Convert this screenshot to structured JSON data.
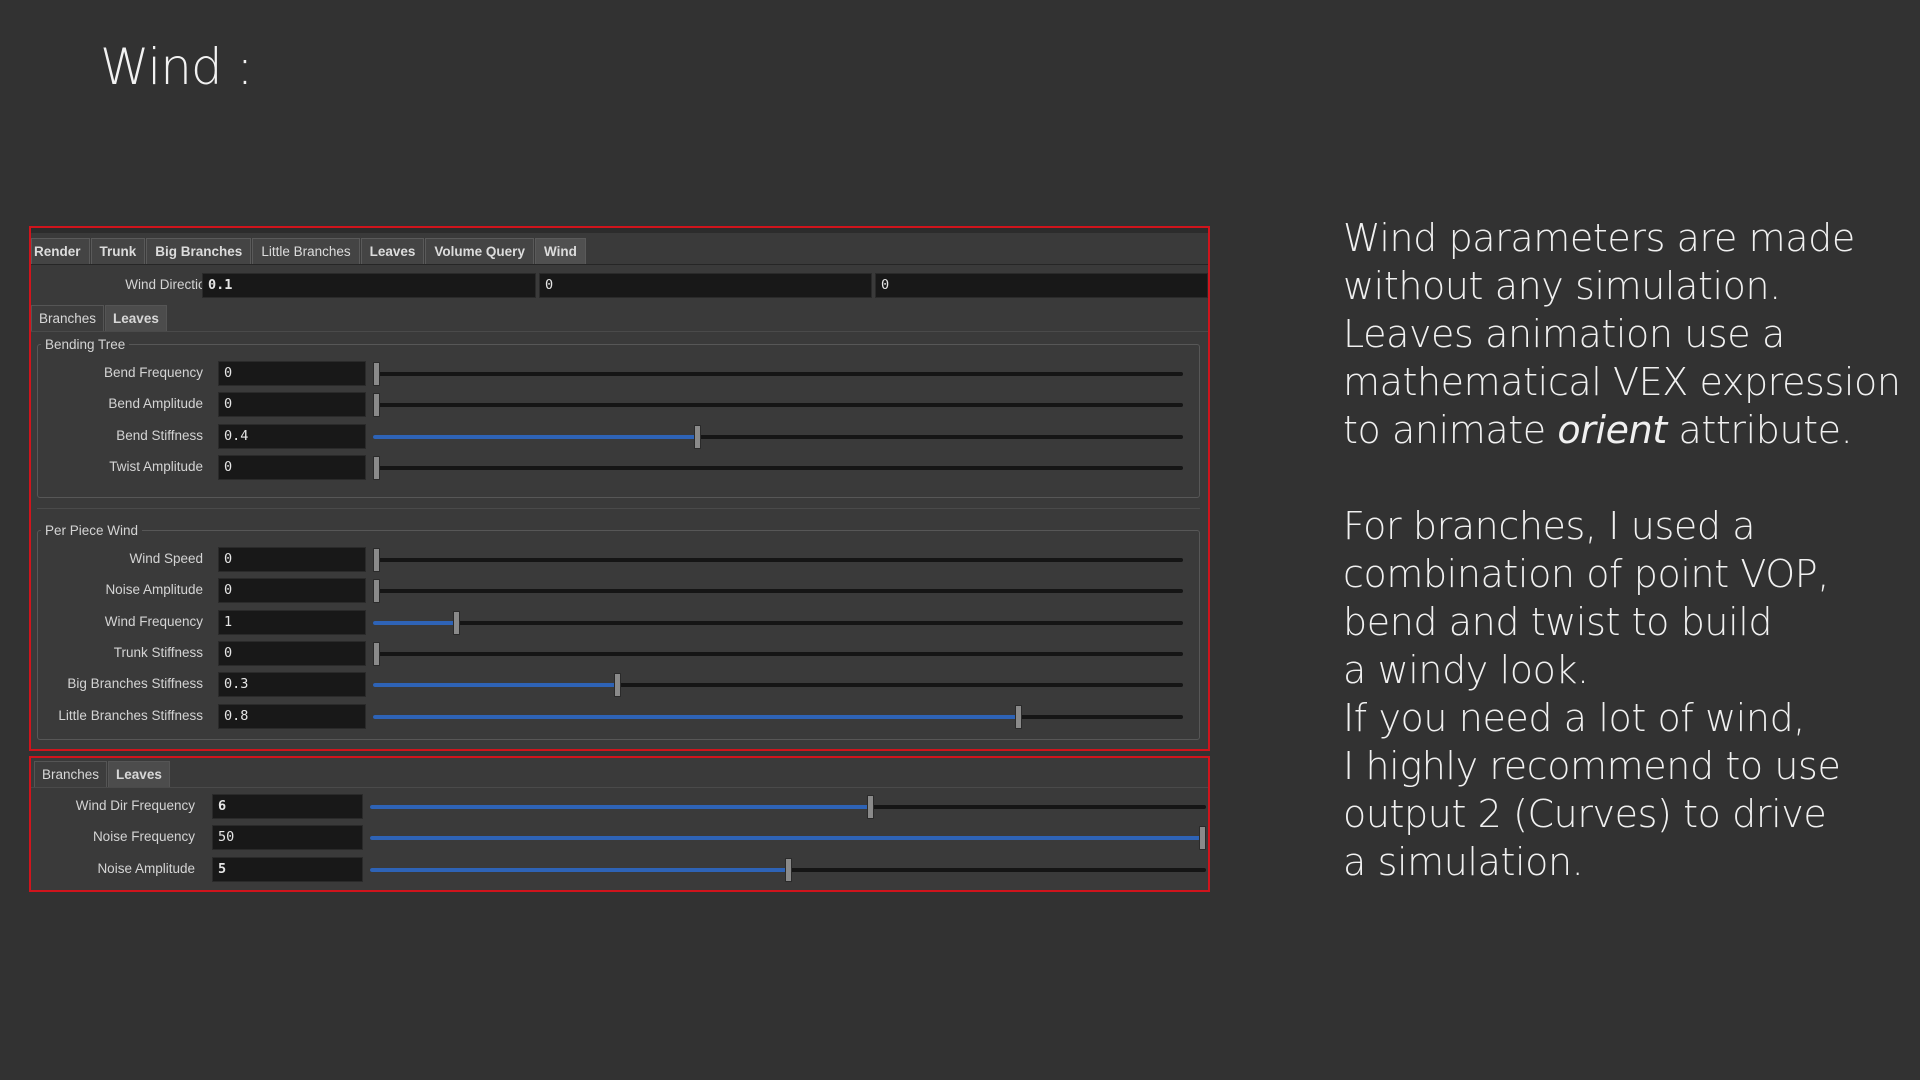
{
  "slide": {
    "title": "Wind :"
  },
  "description": {
    "paragraph1": [
      "Wind parameters are made",
      "without any simulation.",
      "Leaves animation use a",
      "mathematical VEX expression"
    ],
    "paragraph1_last_prefix": "to animate ",
    "paragraph1_last_italic": "orient",
    "paragraph1_last_suffix": " attribute.",
    "paragraph2": [
      "For branches, I used a",
      "combination of point VOP,",
      "bend and twist to build",
      "a windy look.",
      "If you need a lot of wind,",
      "I highly recommend to use",
      "output 2 (Curves) to drive",
      "a simulation."
    ]
  },
  "main_panel": {
    "tabs": [
      {
        "label": "Render",
        "bold": true
      },
      {
        "label": "Trunk",
        "bold": true
      },
      {
        "label": "Big Branches",
        "bold": true
      },
      {
        "label": "Little Branches",
        "bold": false
      },
      {
        "label": "Leaves",
        "bold": true
      },
      {
        "label": "Volume Query",
        "bold": true
      },
      {
        "label": "Wind",
        "bold": true,
        "active": true
      }
    ],
    "wind_direction": {
      "label": "Wind Direction",
      "values": [
        "0.1",
        "0",
        "0"
      ]
    },
    "subtabs": [
      {
        "label": "Branches"
      },
      {
        "label": "Leaves",
        "active": true
      }
    ],
    "bending_tree": {
      "title": "Bending Tree",
      "params": [
        {
          "label": "Bend Frequency",
          "value": "0",
          "fraction": 0.0
        },
        {
          "label": "Bend Amplitude",
          "value": "0",
          "fraction": 0.0
        },
        {
          "label": "Bend Stiffness",
          "value": "0.4",
          "fraction": 0.4
        },
        {
          "label": "Twist Amplitude",
          "value": "0",
          "fraction": 0.0
        }
      ]
    },
    "per_piece_wind": {
      "title": "Per Piece Wind",
      "params": [
        {
          "label": "Wind Speed",
          "value": "0",
          "fraction": 0.0
        },
        {
          "label": "Noise Amplitude",
          "value": "0",
          "fraction": 0.0
        },
        {
          "label": "Wind Frequency",
          "value": "1",
          "fraction": 0.1
        },
        {
          "label": "Trunk Stiffness",
          "value": "0",
          "fraction": 0.0
        },
        {
          "label": "Big Branches Stiffness",
          "value": "0.3",
          "fraction": 0.3
        },
        {
          "label": "Little Branches Stiffness",
          "value": "0.8",
          "fraction": 0.8
        }
      ]
    }
  },
  "bottom_panel": {
    "subtabs": [
      {
        "label": "Branches"
      },
      {
        "label": "Leaves",
        "active": true
      }
    ],
    "params": [
      {
        "label": "Wind Dir Frequency",
        "value": "6",
        "fraction": 0.6
      },
      {
        "label": "Noise Frequency",
        "value": "50",
        "fraction": 1.0
      },
      {
        "label": "Noise Amplitude",
        "value": "5",
        "fraction": 0.5
      }
    ]
  },
  "colors": {
    "background": "#323232",
    "highlight_border": "#d0141c",
    "slider_fill": "#2e63b6"
  }
}
